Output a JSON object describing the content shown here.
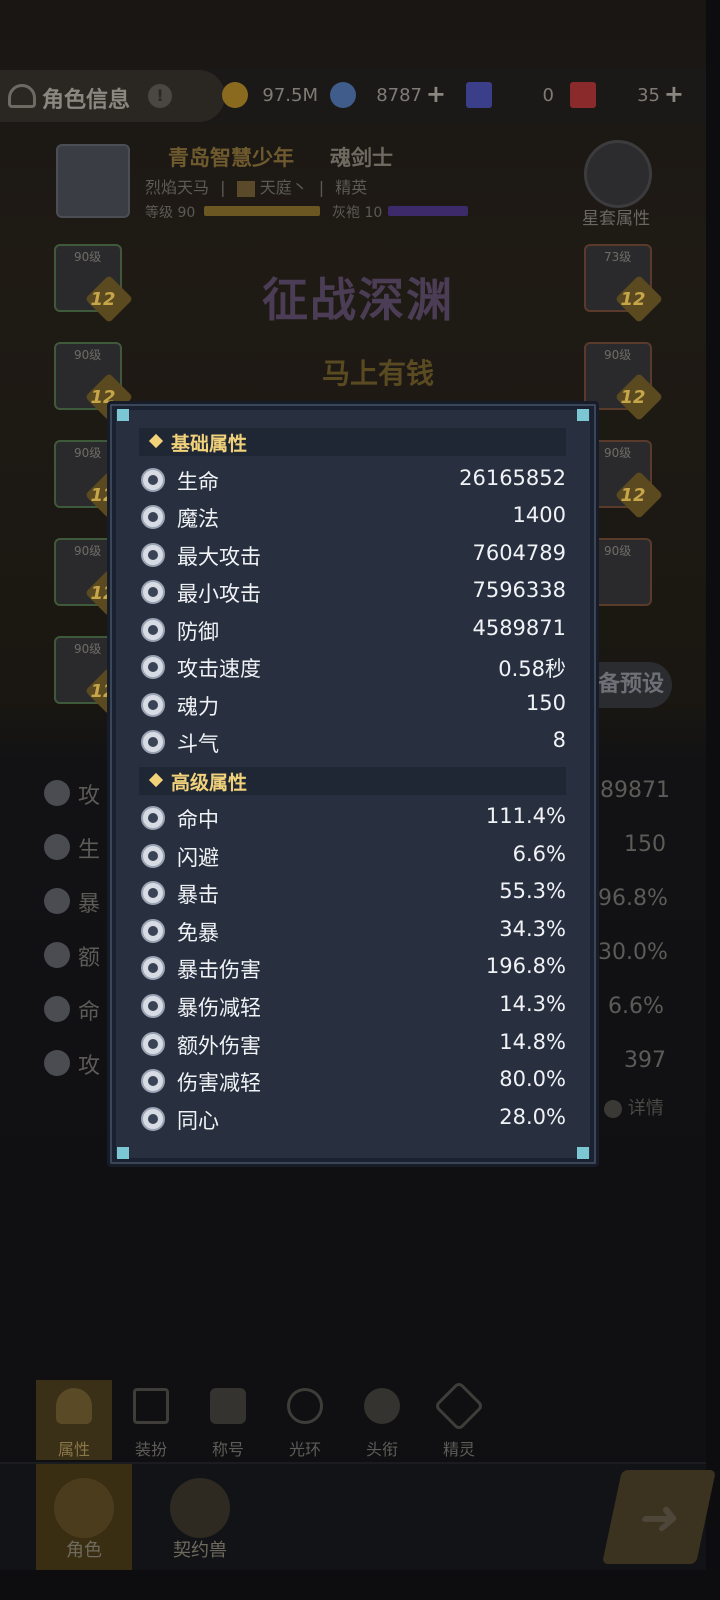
{
  "header": {
    "title": "角色信息",
    "help_glyph": "!",
    "resources": [
      {
        "name": "gold",
        "value": "97.5M",
        "color": "#8a6a1f"
      },
      {
        "name": "crystal",
        "value": "8787",
        "color": "#3f5c8a"
      },
      {
        "name": "ticket-a",
        "value": "0",
        "color": "#3b3f8a"
      },
      {
        "name": "ticket-gold",
        "value": "35",
        "color": "#8a2a2a"
      }
    ]
  },
  "character": {
    "name": "青岛智慧少年",
    "class": "魂剑士",
    "mount": "烈焰天马",
    "guild": "天庭丶",
    "rank": "精英",
    "level_label": "等级 90",
    "robe_label": "灰袍 10",
    "set_attr_label": "星套属性"
  },
  "equipment": {
    "left": [
      {
        "lv": "90级",
        "num": "12"
      },
      {
        "lv": "90级",
        "num": "12"
      },
      {
        "lv": "90级",
        "num": "12"
      },
      {
        "lv": "90级",
        "num": "12"
      },
      {
        "lv": "90级",
        "num": "12"
      }
    ],
    "right": [
      {
        "lv": "73级",
        "num": "12"
      },
      {
        "lv": "90级",
        "num": "12"
      },
      {
        "lv": "90级",
        "num": "12"
      },
      {
        "lv": "90级",
        "num": ""
      }
    ]
  },
  "banner": {
    "title": "征战深渊",
    "sub": "马上有钱"
  },
  "preset_label": "备预设",
  "background_stats": {
    "labels": [
      "攻",
      "生",
      "暴",
      "额",
      "命",
      "攻"
    ],
    "values": [
      "89871",
      "150",
      "96.8%",
      "30.0%",
      "6.6%",
      "397"
    ],
    "detail": "详情"
  },
  "dialog": {
    "basic_title": "基础属性",
    "basic": [
      {
        "label": "生命",
        "value": "26165852",
        "icon": "heart-icon"
      },
      {
        "label": "魔法",
        "value": "1400",
        "icon": "magic-icon"
      },
      {
        "label": "最大攻击",
        "value": "7604789",
        "icon": "sword-icon"
      },
      {
        "label": "最小攻击",
        "value": "7596338",
        "icon": "sword-icon"
      },
      {
        "label": "防御",
        "value": "4589871",
        "icon": "shield-icon"
      },
      {
        "label": "攻击速度",
        "value": "0.58秒",
        "icon": "speed-icon"
      },
      {
        "label": "魂力",
        "value": "150",
        "icon": "soul-icon"
      },
      {
        "label": "斗气",
        "value": "8",
        "icon": "swirl-icon"
      }
    ],
    "advanced_title": "高级属性",
    "advanced": [
      {
        "label": "命中",
        "value": "111.4%",
        "icon": "target-icon"
      },
      {
        "label": "闪避",
        "value": "6.6%",
        "icon": "dodge-icon"
      },
      {
        "label": "暴击",
        "value": "55.3%",
        "icon": "crit-icon"
      },
      {
        "label": "免暴",
        "value": "34.3%",
        "icon": "anti-crit-icon"
      },
      {
        "label": "暴击伤害",
        "value": "196.8%",
        "icon": "crit-damage-icon"
      },
      {
        "label": "暴伤减轻",
        "value": "14.3%",
        "icon": "crit-reduce-icon"
      },
      {
        "label": "额外伤害",
        "value": "14.8%",
        "icon": "extra-damage-icon"
      },
      {
        "label": "伤害减轻",
        "value": "80.0%",
        "icon": "damage-reduce-icon"
      },
      {
        "label": "同心",
        "value": "28.0%",
        "icon": "bond-icon"
      }
    ]
  },
  "tabs": [
    "属性",
    "装扮",
    "称号",
    "光环",
    "头衔",
    "精灵"
  ],
  "bottom_nav": [
    "角色",
    "契约兽"
  ],
  "colors": {
    "accent_gold": "#f1d27a",
    "dialog_bg": "#283040",
    "corner": "#7cc7d4"
  }
}
